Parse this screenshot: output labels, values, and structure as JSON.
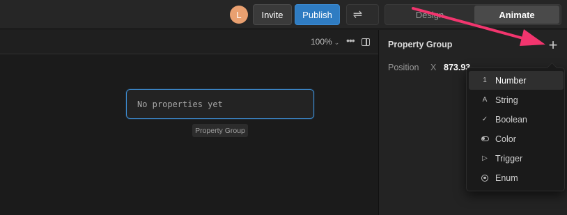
{
  "topbar": {
    "avatar_initial": "L",
    "invite_label": "Invite",
    "publish_label": "Publish",
    "swap_icon": "⇌",
    "mode_tabs": {
      "design": "Design",
      "animate": "Animate"
    }
  },
  "canvas": {
    "zoom": "100%",
    "zoom_chevron": "⌄",
    "more_icon": "•••",
    "empty_text": "No properties yet",
    "group_tag": "Property Group"
  },
  "panel": {
    "title": "Property Group",
    "add_icon": "+",
    "position_label": "Position",
    "x_label": "X",
    "x_value": "873.93"
  },
  "menu": {
    "items": [
      {
        "icon": "1",
        "label": "Number"
      },
      {
        "icon": "A",
        "label": "String"
      },
      {
        "icon": "✓",
        "label": "Boolean"
      },
      {
        "icon": "toggle",
        "label": "Color"
      },
      {
        "icon": "▷",
        "label": "Trigger"
      },
      {
        "icon": "radio",
        "label": "Enum"
      }
    ]
  },
  "colors": {
    "accent_blue": "#2f7cc2",
    "focus_blue": "#3d8fd6",
    "annotation_pink": "#f2356e",
    "avatar": "#e9a070"
  }
}
